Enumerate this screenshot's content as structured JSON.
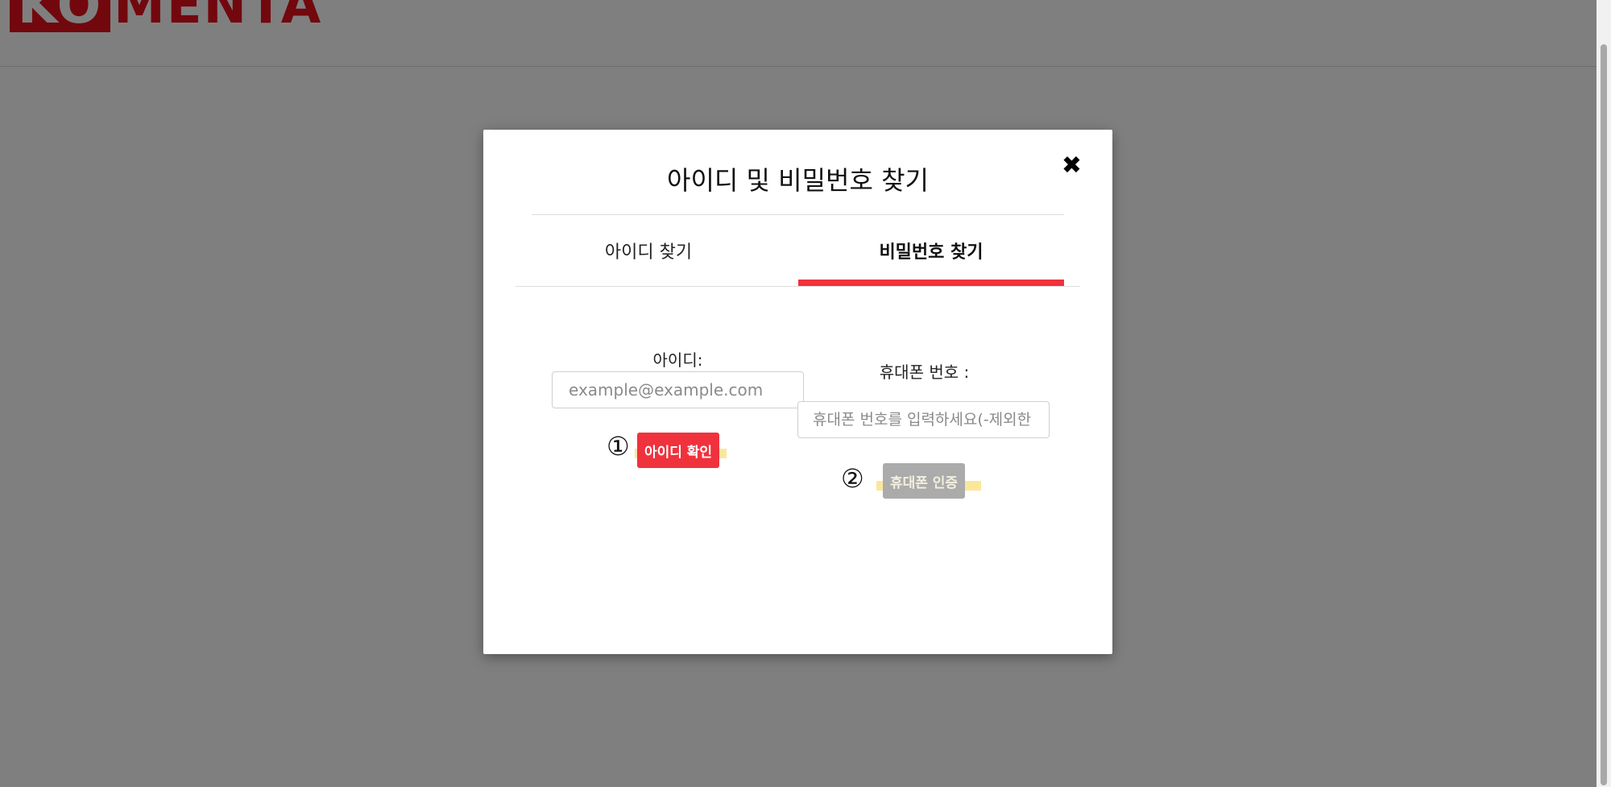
{
  "brand": {
    "logo_box_text": "KO",
    "logo_rest_text": "MENTA"
  },
  "modal": {
    "title": "아이디 및 비밀번호 찾기",
    "close_symbol": "✖",
    "tabs": [
      {
        "label": "아이디 찾기",
        "active": false
      },
      {
        "label": "비밀번호 찾기",
        "active": true
      }
    ],
    "id_field": {
      "label": "아이디:",
      "placeholder": "example@example.com",
      "value": ""
    },
    "phone_field": {
      "label": "휴대폰 번호 :",
      "placeholder": "휴대폰 번호를 입력하세요(-제외한",
      "value": ""
    },
    "step1_marker": "①",
    "step2_marker": "②",
    "check_id_button": "아이디 확인",
    "phone_auth_button": "휴대폰 인증"
  },
  "colors": {
    "accent": "#f0323d",
    "brand_red": "#e5101d",
    "disabled_button": "#ababab",
    "highlight": "#fbe79a",
    "overlay": "rgba(0,0,0,0.5)"
  }
}
